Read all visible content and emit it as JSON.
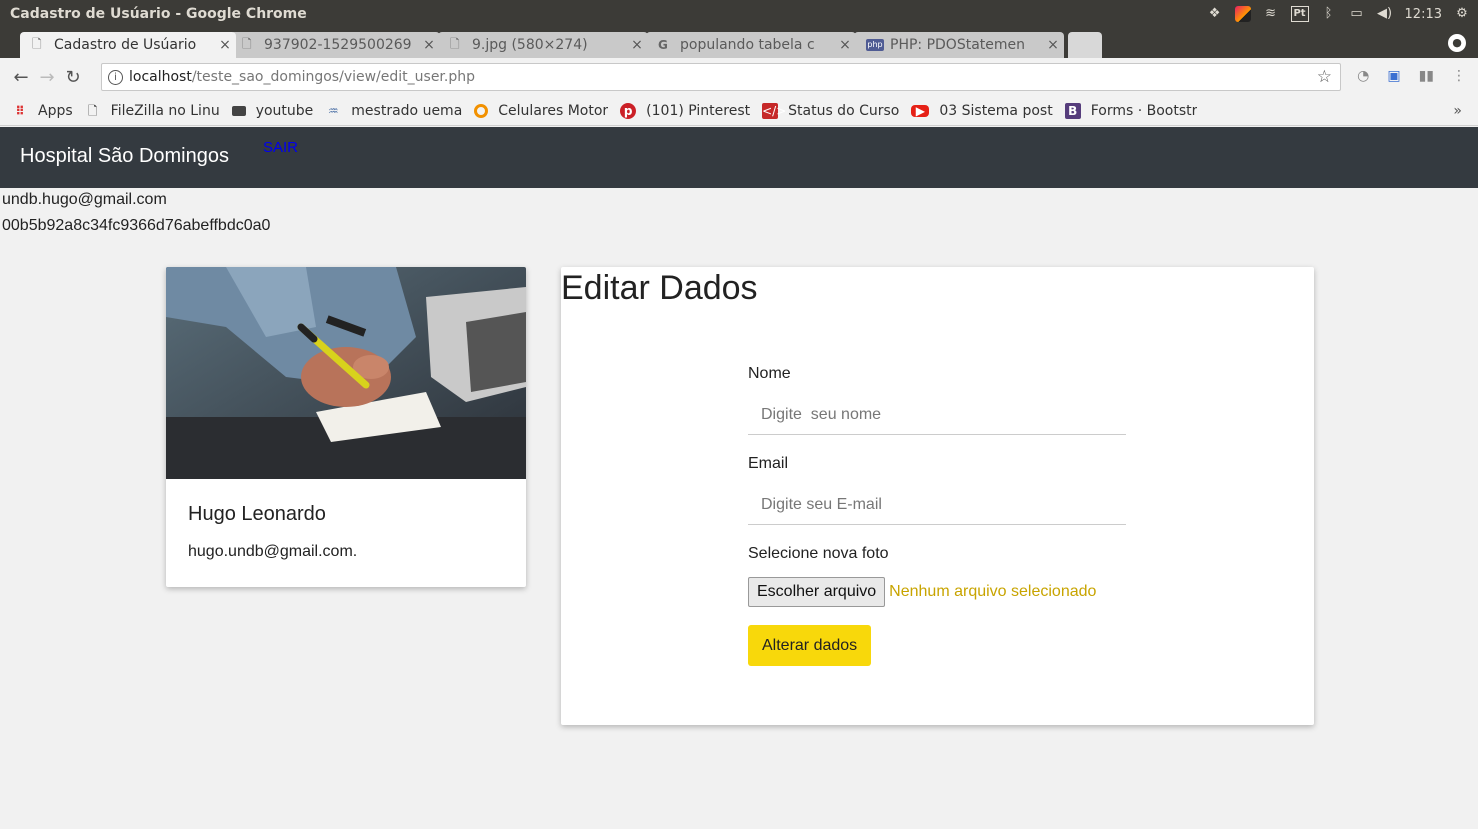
{
  "os": {
    "window_title": "Cadastro de Usúario - Google Chrome",
    "clock": "12:13",
    "tray_pt": "Pt"
  },
  "browser": {
    "tabs": [
      {
        "label": "Cadastro de Usúario",
        "active": true
      },
      {
        "label": "937902-1529500269",
        "active": false
      },
      {
        "label": "9.jpg (580×274)",
        "active": false
      },
      {
        "label": "populando tabela c",
        "active": false
      },
      {
        "label": "PHP: PDOStatemen",
        "active": false
      }
    ],
    "url_host": "localhost",
    "url_path": "/teste_sao_domingos/view/edit_user.php",
    "bookmarks": [
      {
        "label": "Apps",
        "icon": "apps-icon"
      },
      {
        "label": "FileZilla no Linu",
        "icon": "page-icon"
      },
      {
        "label": "youtube",
        "icon": "folder-icon"
      },
      {
        "label": "mestrado uema",
        "icon": "bird-icon"
      },
      {
        "label": "Celulares Motor",
        "icon": "circle-icon"
      },
      {
        "label": "(101) Pinterest",
        "icon": "pinterest-icon"
      },
      {
        "label": "Status do Curso",
        "icon": "code-icon"
      },
      {
        "label": "03 Sistema post",
        "icon": "youtube-icon"
      },
      {
        "label": "Forms · Bootstr",
        "icon": "bootstrap-icon"
      }
    ]
  },
  "page": {
    "brand": "Hospital São Domingos",
    "logout_label": "SAIR",
    "session_email": "undb.hugo@gmail.com",
    "session_hash": "00b5b92a8c34fc9366d76abeffbdc0a0",
    "profile": {
      "name": "Hugo Leonardo",
      "email": "hugo.undb@gmail.com."
    },
    "form": {
      "title": "Editar Dados",
      "name_label": "Nome",
      "name_placeholder": "Digite  seu nome",
      "email_label": "Email",
      "email_placeholder": "Digite seu E-mail",
      "photo_label": "Selecione nova foto",
      "file_button": "Escolher arquivo",
      "file_status": "Nenhum arquivo selecionado",
      "submit_label": "Alterar dados"
    }
  },
  "colors": {
    "navbar_bg": "#343a40",
    "submit_bg": "#f8d80b",
    "file_status": "#c8a400",
    "logout_link": "#0000ee"
  }
}
